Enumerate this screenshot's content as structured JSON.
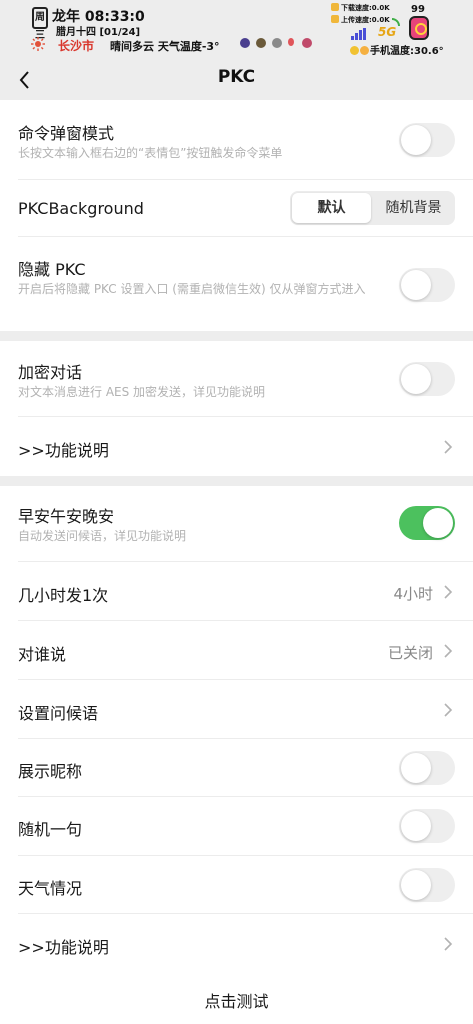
{
  "status_bar": {
    "calendar_glyph": "周三",
    "time": "龙年 08:33:0",
    "lunar_date": "腊月十四 [01/24]",
    "city": "长沙市",
    "weather": "晴间多云  天气温度-3°",
    "download_speed": "下载速度:0.0K",
    "upload_speed": "上传速度:0.0K",
    "network": "5G",
    "battery": "99",
    "phone_temp": "手机温度:30.6°",
    "icons": [
      "calendar-icon",
      "sun-icon",
      "signal-icon",
      "wifi-icon",
      "battery-icon"
    ]
  },
  "nav": {
    "title": "PKC",
    "back_icon": "chevron-left-icon"
  },
  "section1": {
    "cmd_popup": {
      "title": "命令弹窗模式",
      "subtitle": "长按文本输入框右边的“表情包”按钮触发命令菜单",
      "enabled": false
    },
    "background": {
      "title": "PKCBackground",
      "options": [
        "默认",
        "随机背景"
      ],
      "selected": "默认"
    },
    "hide_pkc": {
      "title": "隐藏 PKC",
      "subtitle": "开启后将隐藏 PKC 设置入口 (需重启微信生效) 仅从弹窗方式进入",
      "enabled": false
    }
  },
  "section2": {
    "encrypt": {
      "title": "加密对话",
      "subtitle": "对文本消息进行 AES 加密发送，详见功能说明",
      "enabled": false
    },
    "help": {
      "title": ">>功能说明"
    }
  },
  "section3": {
    "greeting": {
      "title": "早安午安晚安",
      "subtitle": "自动发送问候语，详见功能说明",
      "enabled": true
    },
    "interval": {
      "title": "几小时发1次",
      "value": "4小时"
    },
    "target": {
      "title": "对谁说",
      "value": "已关闭"
    },
    "set_greeting": {
      "title": "设置问候语"
    },
    "show_nickname": {
      "title": "展示昵称",
      "enabled": false
    },
    "random_sentence": {
      "title": "随机一句",
      "enabled": false
    },
    "weather": {
      "title": "天气情况",
      "enabled": false
    },
    "help": {
      "title": ">>功能说明"
    },
    "test": {
      "label": "点击测试"
    }
  },
  "colors": {
    "toggle_on": "#4cc15e",
    "page_bg": "#ededed",
    "city_red": "#d9362c"
  }
}
